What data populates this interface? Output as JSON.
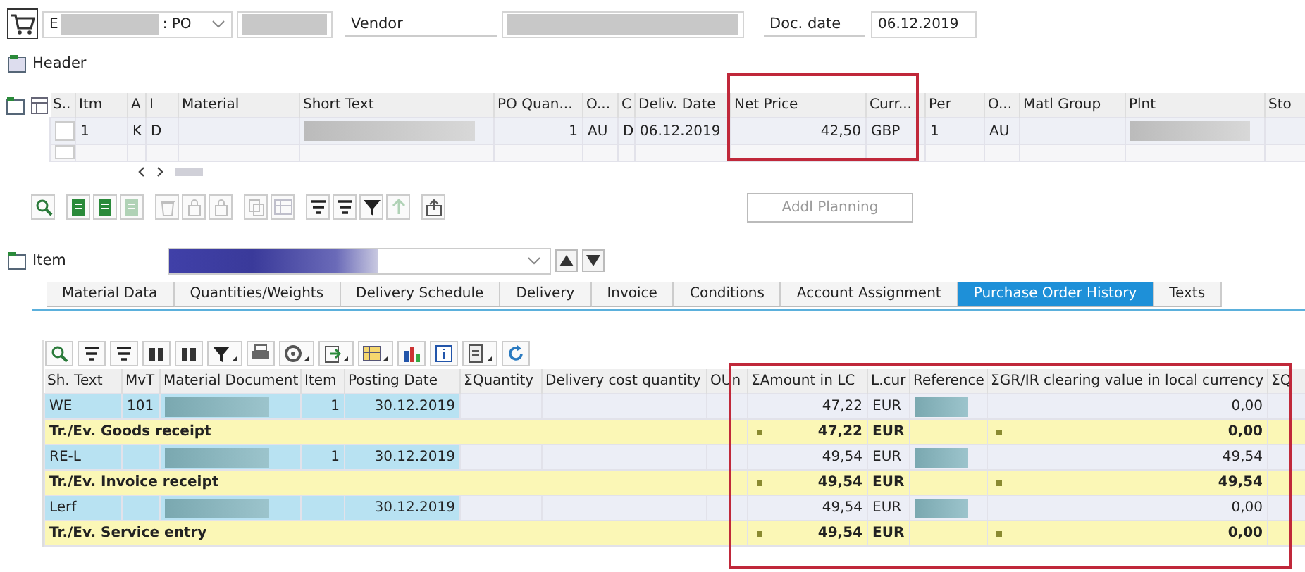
{
  "top": {
    "order_type": {
      "prefix": "E",
      "suffix": ": PO"
    },
    "vendor_label": "Vendor",
    "doc_date_label": "Doc. date",
    "doc_date": "06.12.2019"
  },
  "header_section": {
    "label": "Header"
  },
  "items_table": {
    "columns": [
      "S..",
      "Itm",
      "A",
      "I",
      "Material",
      "Short Text",
      "PO Quan...",
      "O...",
      "C",
      "Deliv. Date",
      "Net Price",
      "Curr...",
      "Per",
      "O...",
      "Matl Group",
      "Plnt",
      "Sto"
    ],
    "rows": [
      {
        "cells": [
          {},
          {
            "text": "1"
          },
          {
            "text": "K"
          },
          {
            "text": "D"
          },
          {},
          {
            "redacted": true
          },
          {
            "text": "1"
          },
          {
            "text": "AU"
          },
          {
            "text": "D"
          },
          {
            "text": "06.12.2019"
          },
          {
            "text": "42,50"
          },
          {
            "text": "GBP"
          },
          {
            "text": "1"
          },
          {
            "text": "AU"
          },
          {},
          {
            "redacted": true
          },
          {}
        ]
      },
      {
        "cells": [
          {},
          {},
          {},
          {},
          {},
          {},
          {},
          {},
          {},
          {},
          {},
          {},
          {},
          {},
          {},
          {},
          {}
        ]
      }
    ]
  },
  "items_toolbar": [
    {
      "kind": "search",
      "disabled": false
    },
    {
      "kind": "doc",
      "disabled": false
    },
    {
      "kind": "doc",
      "disabled": false
    },
    {
      "kind": "doc",
      "disabled": true
    },
    {
      "kind": "trash",
      "disabled": true
    },
    {
      "kind": "lock",
      "disabled": true
    },
    {
      "kind": "lock",
      "disabled": true
    },
    {
      "kind": "copy",
      "disabled": true
    },
    {
      "kind": "grid",
      "disabled": true
    },
    {
      "kind": "sort",
      "disabled": false
    },
    {
      "kind": "sort",
      "disabled": false
    },
    {
      "kind": "filter",
      "disabled": false
    },
    {
      "kind": "arrow",
      "disabled": true
    },
    {
      "kind": "upload",
      "disabled": false
    }
  ],
  "addl_planning_button": "Addl Planning",
  "item_section": {
    "label": "Item"
  },
  "tabs": [
    {
      "label": "Material Data",
      "selected": false
    },
    {
      "label": "Quantities/Weights",
      "selected": false
    },
    {
      "label": "Delivery Schedule",
      "selected": false
    },
    {
      "label": "Delivery",
      "selected": false
    },
    {
      "label": "Invoice",
      "selected": false
    },
    {
      "label": "Conditions",
      "selected": false
    },
    {
      "label": "Account Assignment",
      "selected": false
    },
    {
      "label": "Purchase Order History",
      "selected": true
    },
    {
      "label": "Texts",
      "selected": false
    }
  ],
  "history_toolbar": [
    {
      "kind": "search",
      "has_menu": false
    },
    {
      "kind": "sort",
      "has_menu": false
    },
    {
      "kind": "sort",
      "has_menu": false
    },
    {
      "kind": "find",
      "has_menu": false
    },
    {
      "kind": "find",
      "has_menu": false
    },
    {
      "kind": "filter",
      "has_menu": true
    },
    {
      "kind": "print",
      "has_menu": false
    },
    {
      "kind": "settings",
      "has_menu": true
    },
    {
      "kind": "upload",
      "has_menu": true
    },
    {
      "kind": "grid",
      "has_menu": true
    },
    {
      "kind": "chart",
      "has_menu": false
    },
    {
      "kind": "info",
      "has_menu": false
    },
    {
      "kind": "doc",
      "has_menu": true
    },
    {
      "kind": "refresh",
      "has_menu": false
    }
  ],
  "history_table": {
    "columns": [
      "Sh. Text",
      "MvT",
      "Material Document",
      "Item",
      "Posting Date",
      "ΣQuantity",
      "Delivery cost quantity",
      "OUn",
      "ΣAmount in LC",
      "L.cur",
      "Reference",
      "ΣGR/IR clearing value in local currency",
      "ΣQ"
    ],
    "rows": [
      {
        "kind": "item",
        "cells": [
          {
            "text": "WE"
          },
          {
            "text": "101"
          },
          {
            "redacted": true
          },
          {
            "text": "1"
          },
          {
            "text": "30.12.2019"
          },
          {},
          {},
          {},
          {
            "text": "47,22"
          },
          {
            "text": "EUR"
          },
          {
            "redacted": true
          },
          {
            "text": "0,00"
          },
          {}
        ]
      },
      {
        "kind": "total",
        "label": "Tr./Ev. Goods receipt",
        "amount": "47,22",
        "currency": "EUR",
        "gr_ir": "0,00"
      },
      {
        "kind": "item",
        "cells": [
          {
            "text": "RE-L"
          },
          {},
          {
            "redacted": true
          },
          {
            "text": "1"
          },
          {
            "text": "30.12.2019"
          },
          {},
          {},
          {},
          {
            "text": "49,54"
          },
          {
            "text": "EUR"
          },
          {
            "redacted": true
          },
          {
            "text": "49,54"
          },
          {}
        ]
      },
      {
        "kind": "total",
        "label": "Tr./Ev. Invoice receipt",
        "amount": "49,54",
        "currency": "EUR",
        "gr_ir": "49,54"
      },
      {
        "kind": "item",
        "cells": [
          {
            "text": "Lerf"
          },
          {},
          {
            "redacted": true
          },
          {},
          {
            "text": "30.12.2019"
          },
          {},
          {},
          {},
          {
            "text": "49,54"
          },
          {
            "text": "EUR"
          },
          {
            "redacted": true
          },
          {
            "text": "0,00"
          },
          {}
        ]
      },
      {
        "kind": "total",
        "label": "Tr./Ev. Service entry",
        "amount": "49,54",
        "currency": "EUR",
        "gr_ir": "0,00"
      }
    ]
  }
}
